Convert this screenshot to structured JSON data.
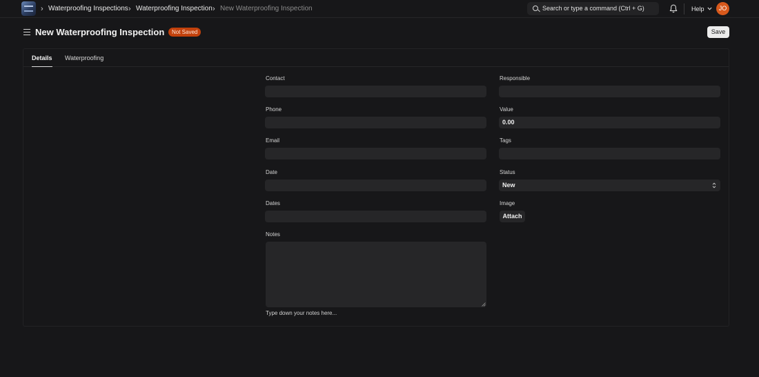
{
  "navbar": {
    "breadcrumbs": [
      "Waterproofing Inspections",
      "Waterproofing Inspection",
      "New Waterproofing Inspection"
    ],
    "search_placeholder": "Search or type a command (Ctrl + G)",
    "help_label": "Help",
    "avatar_initials": "JO",
    "icons": {
      "logo": "app-logo",
      "search": "search-icon",
      "bell": "bell-icon",
      "help": "chevron-down-icon"
    }
  },
  "page": {
    "title": "New Waterproofing Inspection",
    "status_badge": "Not Saved",
    "save_label": "Save",
    "menu_icon": "hamburger-icon"
  },
  "tabs": [
    {
      "label": "Details",
      "active": true
    },
    {
      "label": "Waterproofing",
      "active": false
    }
  ],
  "form": {
    "contact": {
      "label": "Contact",
      "value": ""
    },
    "phone": {
      "label": "Phone",
      "value": ""
    },
    "email": {
      "label": "Email",
      "value": ""
    },
    "date": {
      "label": "Date",
      "value": ""
    },
    "dates": {
      "label": "Dates",
      "value": ""
    },
    "notes": {
      "label": "Notes",
      "value": "",
      "help": "Type down your notes here..."
    },
    "responsible": {
      "label": "Responsible",
      "value": ""
    },
    "value": {
      "label": "Value",
      "value": "0.00"
    },
    "tags": {
      "label": "Tags",
      "value": ""
    },
    "status": {
      "label": "Status",
      "value": "New"
    },
    "image": {
      "label": "Image",
      "attach_label": "Attach"
    }
  },
  "colors": {
    "background": "#171719",
    "input": "#262628",
    "badge": "#c2410c",
    "avatar": "#d8591c"
  }
}
